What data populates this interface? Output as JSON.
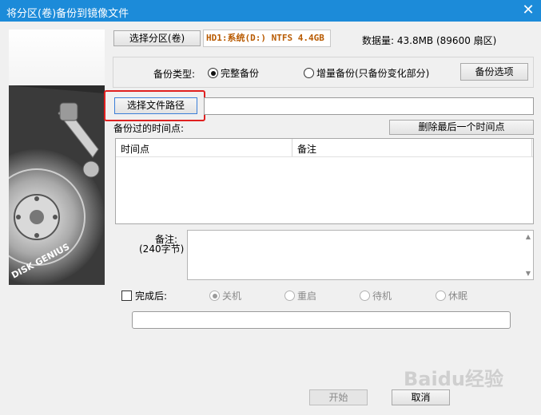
{
  "window": {
    "title": "将分区(卷)备份到镜像文件",
    "close_glyph": "✕"
  },
  "source": {
    "button_label": "选择分区(卷)",
    "partition_text": "HD1:系统(D:) NTFS 4.4GB",
    "data_size_text": "数据量: 43.8MB (89600 扇区)"
  },
  "backup_type": {
    "label": "备份类型:",
    "option_full": "完整备份",
    "option_incremental": "增量备份(只备份变化部分)",
    "selected": "full",
    "options_button": "备份选项"
  },
  "file_path": {
    "button_label": "选择文件路径",
    "value": ""
  },
  "timepoints": {
    "label": "备份过的时间点:",
    "delete_button": "删除最后一个时间点",
    "columns": [
      "时间点",
      "备注"
    ],
    "rows": []
  },
  "note": {
    "label": "备注:",
    "hint": "(240字节)",
    "value": ""
  },
  "after_completion": {
    "label": "完成后:",
    "options": [
      "关机",
      "重启",
      "待机",
      "休眠"
    ],
    "selected": "关机"
  },
  "status_text": "",
  "footer": {
    "start_button": "开始",
    "cancel_button": "取消"
  },
  "graphic": {
    "brand": "DISK GENIUS"
  },
  "watermark": "Baidu经验",
  "colors": {
    "titlebar": "#1c8bd9",
    "highlight": "#e02020",
    "partition_text": "#b85a00"
  }
}
